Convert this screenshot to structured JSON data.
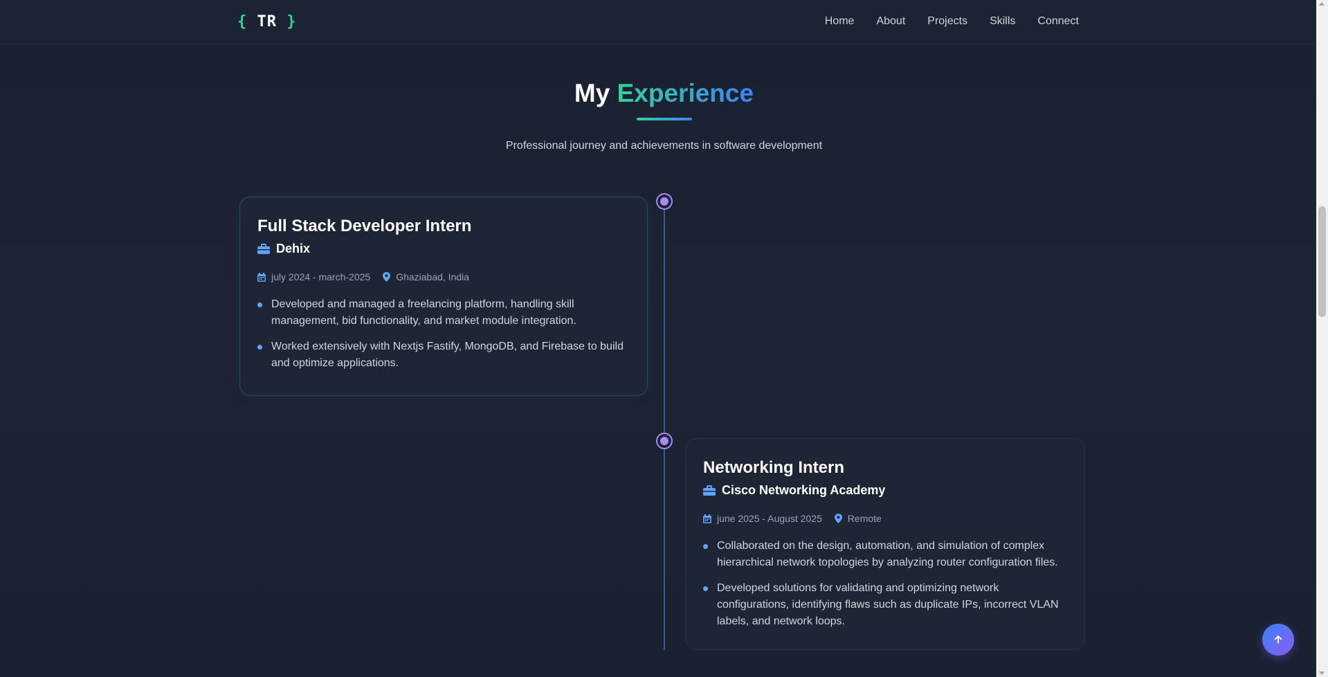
{
  "nav": {
    "logo": {
      "open_brace": "{",
      "text": "TR",
      "close_brace": "}"
    },
    "links": [
      {
        "label": "Home"
      },
      {
        "label": "About"
      },
      {
        "label": "Projects"
      },
      {
        "label": "Skills"
      },
      {
        "label": "Connect"
      }
    ]
  },
  "section": {
    "title_plain": "My",
    "title_accent": "Experience",
    "subtitle": "Professional journey and achievements in software development"
  },
  "experiences": [
    {
      "role": "Full Stack Developer Intern",
      "company": "Dehix",
      "dates": "july 2024 - march-2025",
      "location": "Ghaziabad, India",
      "bullets": [
        "Developed and managed a freelancing platform, handling skill management, bid functionality, and market module integration.",
        "Worked extensively with Nextjs Fastify, MongoDB, and Firebase to build and optimize applications."
      ]
    },
    {
      "role": "Networking Intern",
      "company": "Cisco Networking Academy",
      "dates": "june 2025 - August 2025",
      "location": "Remote",
      "bullets": [
        "Collaborated on the design, automation, and simulation of complex hierarchical network topologies by analyzing router configuration files.",
        "Developed solutions for validating and optimizing network configurations, identifying flaws such as duplicate IPs, incorrect VLAN labels, and network loops."
      ]
    }
  ],
  "icons": {
    "briefcase": "briefcase-icon",
    "calendar": "calendar-icon",
    "location": "map-pin-icon",
    "scroll_top": "arrow-up-icon"
  },
  "colors": {
    "background": "#1b2232",
    "accent_green": "#34d399",
    "accent_blue": "#3b82f6",
    "timeline_dot": "#a78bfa",
    "bullet": "#60a5fa"
  }
}
